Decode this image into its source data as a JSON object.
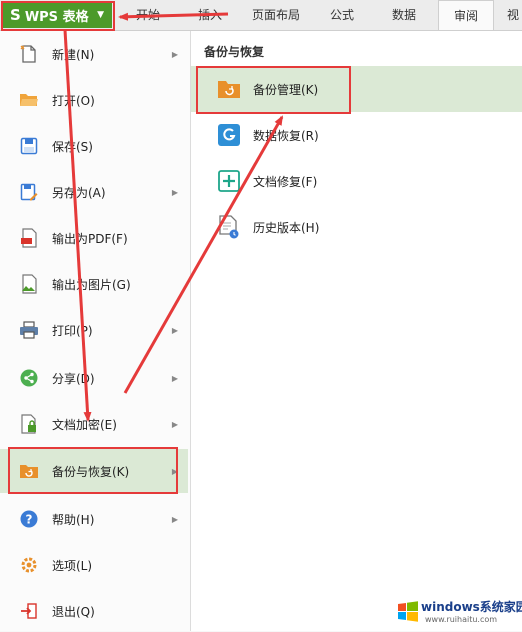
{
  "header": {
    "app_button_label": "WPS 表格",
    "tabs": [
      "开始",
      "插入",
      "页面布局",
      "公式",
      "数据",
      "审阅",
      "视"
    ],
    "active_tab": "审阅"
  },
  "left_menu": {
    "items": [
      {
        "label": "新建(N)",
        "icon": "new-file-icon",
        "has_submenu": true
      },
      {
        "label": "打开(O)",
        "icon": "folder-open-icon",
        "has_submenu": false
      },
      {
        "label": "保存(S)",
        "icon": "save-icon",
        "has_submenu": false
      },
      {
        "label": "另存为(A)",
        "icon": "save-as-icon",
        "has_submenu": true
      },
      {
        "label": "输出为PDF(F)",
        "icon": "pdf-icon",
        "has_submenu": false
      },
      {
        "label": "输出为图片(G)",
        "icon": "image-export-icon",
        "has_submenu": false
      },
      {
        "label": "打印(P)",
        "icon": "printer-icon",
        "has_submenu": true
      },
      {
        "label": "分享(D)",
        "icon": "share-icon",
        "has_submenu": true
      },
      {
        "label": "文档加密(E)",
        "icon": "lock-doc-icon",
        "has_submenu": true
      },
      {
        "label": "备份与恢复(K)",
        "icon": "backup-restore-icon",
        "has_submenu": true,
        "selected": true
      },
      {
        "label": "帮助(H)",
        "icon": "help-icon",
        "has_submenu": true
      },
      {
        "label": "选项(L)",
        "icon": "gear-icon",
        "has_submenu": false
      },
      {
        "label": "退出(Q)",
        "icon": "exit-icon",
        "has_submenu": false
      }
    ]
  },
  "submenu": {
    "title": "备份与恢复",
    "items": [
      {
        "label": "备份管理(K)",
        "icon": "backup-folder-icon",
        "selected": true
      },
      {
        "label": "数据恢复(R)",
        "icon": "data-recovery-icon"
      },
      {
        "label": "文档修复(F)",
        "icon": "document-repair-icon"
      },
      {
        "label": "历史版本(H)",
        "icon": "history-version-icon"
      }
    ]
  },
  "watermark": {
    "title": "windows系统家园",
    "url": "www.ruihaitu.com"
  },
  "colors": {
    "accent_green": "#4c9a2a",
    "selected_bg": "#dbe9d5",
    "annotation_red": "#e53a3a"
  }
}
